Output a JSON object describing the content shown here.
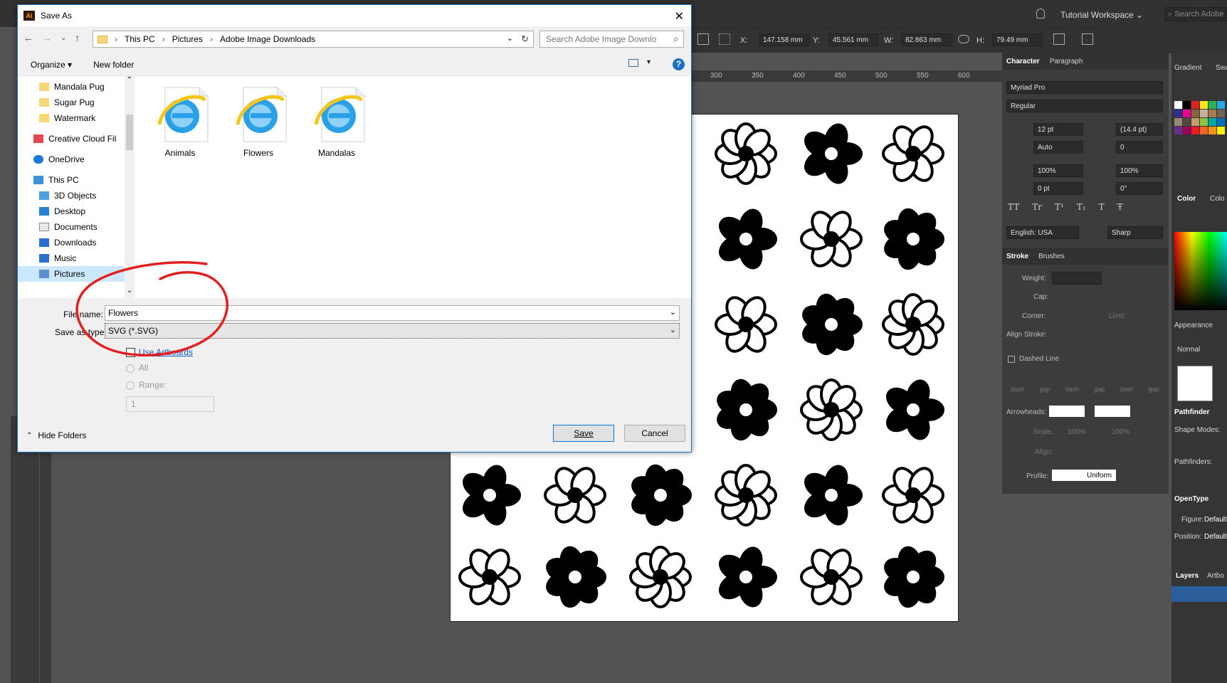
{
  "dialog": {
    "title": "Save As",
    "app_badge": "Ai",
    "breadcrumb": [
      "This PC",
      "Pictures",
      "Adobe Image Downloads"
    ],
    "search_placeholder": "Search Adobe Image Downlo",
    "toolbar": {
      "organize": "Organize",
      "new_folder": "New folder"
    },
    "nav_items": [
      {
        "label": "Mandala Pug",
        "icon": "folder-icon"
      },
      {
        "label": "Sugar Pug",
        "icon": "folder-icon"
      },
      {
        "label": "Watermark",
        "icon": "folder-icon"
      },
      {
        "label": "Creative Cloud Fil",
        "icon": "creative-cloud-icon"
      },
      {
        "label": "OneDrive",
        "icon": "cloud-icon"
      },
      {
        "label": "This PC",
        "icon": "computer-icon"
      },
      {
        "label": "3D Objects",
        "icon": "cube-icon"
      },
      {
        "label": "Desktop",
        "icon": "desktop-icon"
      },
      {
        "label": "Documents",
        "icon": "document-icon"
      },
      {
        "label": "Downloads",
        "icon": "download-icon"
      },
      {
        "label": "Music",
        "icon": "music-icon"
      },
      {
        "label": "Pictures",
        "icon": "pictures-icon"
      }
    ],
    "files": [
      {
        "name": "Animals",
        "icon": "ie-file-icon"
      },
      {
        "name": "Flowers",
        "icon": "ie-file-icon"
      },
      {
        "name": "Mandalas",
        "icon": "ie-file-icon"
      }
    ],
    "file_name_label": "File name:",
    "file_name_value": "Flowers",
    "save_type_label": "Save as type:",
    "save_type_value": "SVG (*.SVG)",
    "use_artboards": "Use Artboards",
    "all_label": "All",
    "range_label": "Range:",
    "range_value": "1",
    "hide_folders": "Hide Folders",
    "save": "Save",
    "cancel": "Cancel"
  },
  "illustrator": {
    "workspace": "Tutorial Workspace",
    "search_placeholder": "Search Adobe",
    "x_label": "X:",
    "x_value": "147.158 mm",
    "y_label": "Y:",
    "y_value": "45.561 mm",
    "w_label": "W:",
    "w_value": "82.863 mm",
    "h_label": "H:",
    "h_value": "79.49 mm",
    "ruler_marks": [
      "300",
      "350",
      "400",
      "450",
      "500",
      "550",
      "600"
    ],
    "character_panel": {
      "tabs": [
        "Character",
        "Paragraph"
      ],
      "font": "Myriad Pro",
      "style": "Regular",
      "size": "12 pt",
      "leading": "(14.4 pt)",
      "kerning": "Auto",
      "tracking": "0",
      "vscale": "100%",
      "hscale": "100%",
      "baseline": "0 pt",
      "rotation": "0°",
      "language": "English: USA",
      "antialias": "Sharp",
      "text_buttons": [
        "TT",
        "Tr",
        "T¹",
        "T₁",
        "T",
        "Ŧ"
      ]
    },
    "stroke_panel": {
      "tabs": [
        "Stroke",
        "Brushes"
      ],
      "weight": "Weight:",
      "cap": "Cap:",
      "corner": "Corner:",
      "limit": "Limit:",
      "align": "Align Stroke:",
      "dashed": "Dashed Line",
      "dash_labels": [
        "dash",
        "gap",
        "dash",
        "gap",
        "dash",
        "gap"
      ],
      "arrowheads": "Arrowheads:",
      "scale": "Scale:",
      "scale_a": "100%",
      "scale_b": "100%",
      "align2": "Align:",
      "profile": "Profile:",
      "profile_value": "Uniform"
    },
    "right_col": {
      "gradient": "Gradient",
      "swatches": "Swa",
      "color": "Color",
      "color2": "Colo",
      "appearance": "Appearance",
      "blend": "Normal",
      "pathfinder": "Pathfinder",
      "shape_modes": "Shape Modes:",
      "pathfinders": "Pathfinders:",
      "opentype": "OpenType",
      "figure": "Figure:",
      "figure_value": "Default",
      "position": "Position:",
      "position_value": "Default",
      "layers": "Layers",
      "artboards": "Artbo"
    },
    "swatch_colors": [
      "#ffffff",
      "#000000",
      "#e02020",
      "#f7e61a",
      "#2db34a",
      "#27aae1",
      "#2e3192",
      "#ec008c",
      "#8c6239",
      "#c7b299",
      "#a67c52",
      "#736357",
      "#998675",
      "#534741",
      "#c69c6d",
      "#8dc63f",
      "#00a99d",
      "#0072bc",
      "#662d91",
      "#9e005d",
      "#ed1c24",
      "#f26522",
      "#f7941d",
      "#fff200"
    ]
  }
}
